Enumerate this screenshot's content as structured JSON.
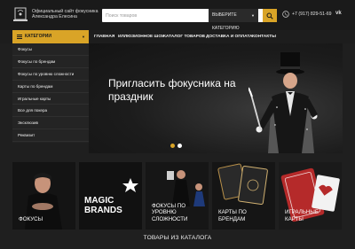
{
  "header": {
    "site_title": "Официальный сайт фокусника Александра Елесина",
    "search_placeholder": "Поиск товаров",
    "search_category": "ВЫБЕРИТЕ КАТЕГОРИЮ",
    "phone": "+7 (917) 829-51-69",
    "social": "vk"
  },
  "nav": {
    "categories_label": "КАТЕГОРИИ",
    "links": [
      "ГЛАВНАЯ",
      "ИЛЛЮЗИОННОЕ ШОУ",
      "КАТАЛОГ ТОВАРОВ",
      "ДОСТАВКА И ОПЛАТА",
      "КОНТАКТЫ"
    ]
  },
  "sidebar": {
    "items": [
      "Фокусы",
      "Фокусы по брендам",
      "Фокусы по уровню сложности",
      "Карты по брендам",
      "Игральные карты",
      "Все для покера",
      "Эксклюзив",
      "Реквизит"
    ]
  },
  "hero": {
    "title": "Пригласить фокусника на праздник",
    "slides": 2,
    "active_slide": 0
  },
  "tiles": [
    {
      "label": "ФОКУСЫ"
    },
    {
      "label": "MAGIC BRANDS",
      "overlay_text": "MAGIC BRANDS"
    },
    {
      "label": "ФОКУСЫ ПО УРОВНЮ СЛОЖНОСТИ"
    },
    {
      "label": "КАРТЫ ПО БРЕНДАМ"
    },
    {
      "label": "ИГРАЛЬНЫЕ КАРТЫ"
    }
  ],
  "section": {
    "title": "ТОВАРЫ ИЗ КАТАЛОГА"
  },
  "colors": {
    "accent": "#d9a427",
    "background": "#1f1f1f",
    "card_red": "#b52a2a"
  }
}
